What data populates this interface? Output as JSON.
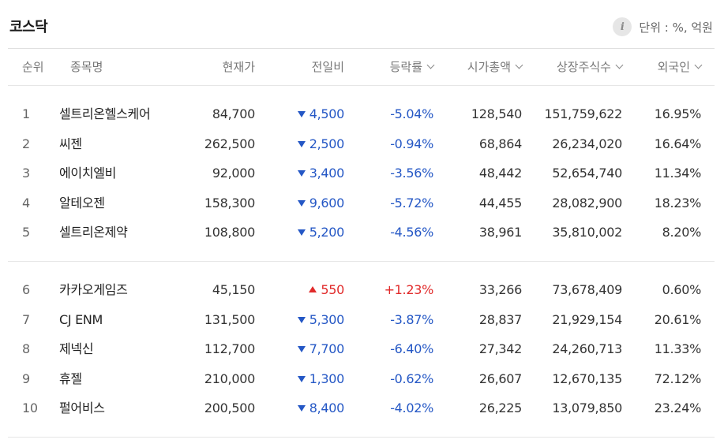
{
  "title": "코스닥",
  "unit_label": "단위 : %, 억원",
  "info_icon_glyph": "i",
  "colors": {
    "down": "#2457c5",
    "up": "#e12a2a",
    "header_text": "#777777",
    "border": "#e6e6e6"
  },
  "columns": {
    "rank": "순위",
    "name": "종목명",
    "price": "현재가",
    "change": "전일비",
    "rate": "등락률",
    "market_cap": "시가총액",
    "shares": "상장주식수",
    "foreign": "외국인"
  },
  "rows": [
    {
      "rank": "1",
      "name": "셀트리온헬스케어",
      "price": "84,700",
      "change": "4,500",
      "direction": "down",
      "rate": "-5.04%",
      "market_cap": "128,540",
      "shares": "151,759,622",
      "foreign": "16.95%"
    },
    {
      "rank": "2",
      "name": "씨젠",
      "price": "262,500",
      "change": "2,500",
      "direction": "down",
      "rate": "-0.94%",
      "market_cap": "68,864",
      "shares": "26,234,020",
      "foreign": "16.64%"
    },
    {
      "rank": "3",
      "name": "에이치엘비",
      "price": "92,000",
      "change": "3,400",
      "direction": "down",
      "rate": "-3.56%",
      "market_cap": "48,442",
      "shares": "52,654,740",
      "foreign": "11.34%"
    },
    {
      "rank": "4",
      "name": "알테오젠",
      "price": "158,300",
      "change": "9,600",
      "direction": "down",
      "rate": "-5.72%",
      "market_cap": "44,455",
      "shares": "28,082,900",
      "foreign": "18.23%"
    },
    {
      "rank": "5",
      "name": "셀트리온제약",
      "price": "108,800",
      "change": "5,200",
      "direction": "down",
      "rate": "-4.56%",
      "market_cap": "38,961",
      "shares": "35,810,002",
      "foreign": "8.20%"
    },
    {
      "rank": "6",
      "name": "카카오게임즈",
      "price": "45,150",
      "change": "550",
      "direction": "up",
      "rate": "+1.23%",
      "market_cap": "33,266",
      "shares": "73,678,409",
      "foreign": "0.60%"
    },
    {
      "rank": "7",
      "name": "CJ ENM",
      "price": "131,500",
      "change": "5,300",
      "direction": "down",
      "rate": "-3.87%",
      "market_cap": "28,837",
      "shares": "21,929,154",
      "foreign": "20.61%"
    },
    {
      "rank": "8",
      "name": "제넥신",
      "price": "112,700",
      "change": "7,700",
      "direction": "down",
      "rate": "-6.40%",
      "market_cap": "27,342",
      "shares": "24,260,713",
      "foreign": "11.33%"
    },
    {
      "rank": "9",
      "name": "휴젤",
      "price": "210,000",
      "change": "1,300",
      "direction": "down",
      "rate": "-0.62%",
      "market_cap": "26,607",
      "shares": "12,670,135",
      "foreign": "72.12%"
    },
    {
      "rank": "10",
      "name": "펄어비스",
      "price": "200,500",
      "change": "8,400",
      "direction": "down",
      "rate": "-4.02%",
      "market_cap": "26,225",
      "shares": "13,079,850",
      "foreign": "23.24%"
    }
  ]
}
